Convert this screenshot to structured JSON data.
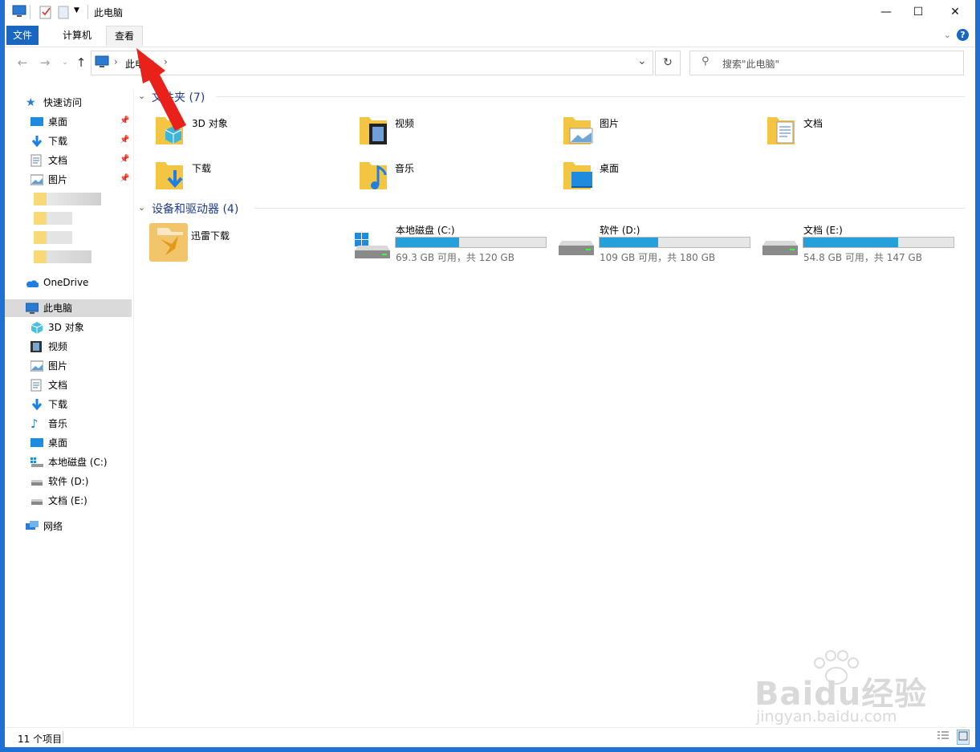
{
  "window": {
    "title": "此电脑"
  },
  "ribbon": {
    "tabs": [
      "文件",
      "计算机",
      "查看"
    ]
  },
  "address": {
    "path_segment": "此电脑"
  },
  "search": {
    "placeholder": "搜索\"此电脑\""
  },
  "sidebar": {
    "quick_access": "快速访问",
    "pinned": [
      "桌面",
      "下载",
      "文档",
      "图片"
    ],
    "onedrive": "OneDrive",
    "this_pc": "此电脑",
    "pc_items": [
      "3D 对象",
      "视频",
      "图片",
      "文档",
      "下载",
      "音乐",
      "桌面",
      "本地磁盘 (C:)",
      "软件 (D:)",
      "文档 (E:)"
    ],
    "network": "网络"
  },
  "folders": {
    "header": "文件夹 (7)",
    "items": [
      "3D 对象",
      "视频",
      "图片",
      "文档",
      "下载",
      "音乐",
      "桌面"
    ]
  },
  "devices": {
    "header": "设备和驱动器 (4)",
    "app": "迅雷下载",
    "drives": [
      {
        "name": "本地磁盘 (C:)",
        "info": "69.3 GB 可用，共 120 GB",
        "used_fraction": 0.42
      },
      {
        "name": "软件 (D:)",
        "info": "109 GB 可用，共 180 GB",
        "used_fraction": 0.39
      },
      {
        "name": "文档 (E:)",
        "info": "54.8 GB 可用，共 147 GB",
        "used_fraction": 0.63
      }
    ]
  },
  "status": {
    "count": "11 个项目"
  },
  "watermark": {
    "brand": "Baidu经验",
    "url": "jingyan.baidu.com"
  },
  "colors": {
    "accent": "#1a66c1",
    "drive_fill": "#26a0da",
    "folder": "#f4c542",
    "annotation_arrow": "#e8221a"
  }
}
